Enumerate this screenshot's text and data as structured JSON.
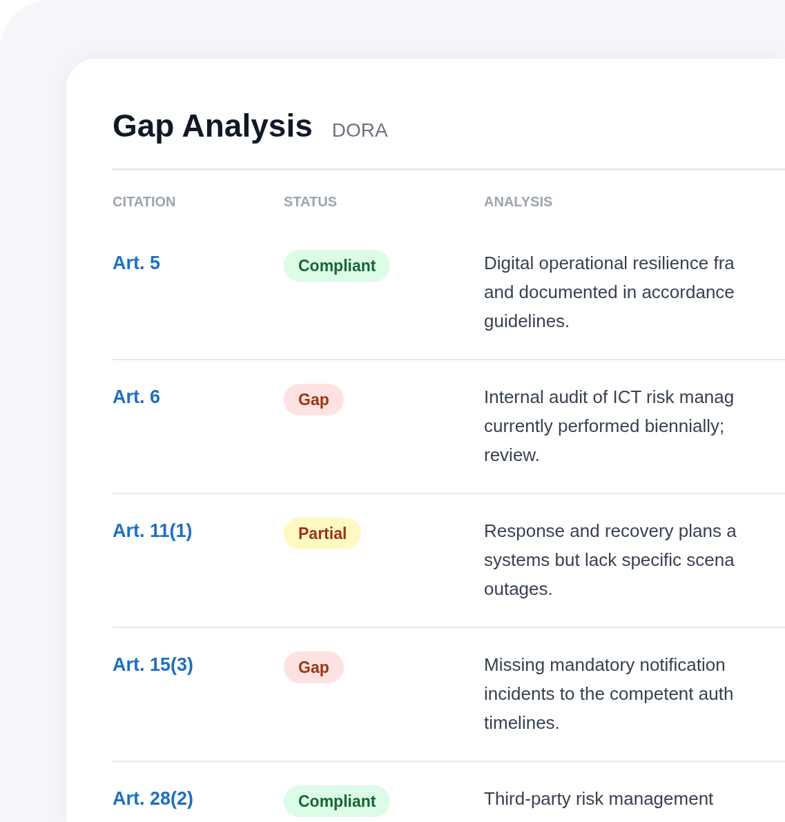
{
  "header": {
    "title": "Gap Analysis",
    "framework": "DORA"
  },
  "table": {
    "columns": [
      "CITATION",
      "STATUS",
      "ANALYSIS"
    ],
    "rows": [
      {
        "citation": "Art. 5",
        "status": {
          "label": "Compliant",
          "kind": "compliant"
        },
        "analysis": "Digital operational resilience fra\nand documented in accordance\nguidelines."
      },
      {
        "citation": "Art. 6",
        "status": {
          "label": "Gap",
          "kind": "gap"
        },
        "analysis": "Internal audit of ICT risk manag\ncurrently performed biennially;\nreview."
      },
      {
        "citation": "Art. 11(1)",
        "status": {
          "label": "Partial",
          "kind": "partial"
        },
        "analysis": "Response and recovery plans a\nsystems but lack specific scena\noutages."
      },
      {
        "citation": "Art. 15(3)",
        "status": {
          "label": "Gap",
          "kind": "gap"
        },
        "analysis": "Missing mandatory notification\nincidents to the competent auth\ntimelines."
      },
      {
        "citation": "Art. 28(2)",
        "status": {
          "label": "Compliant",
          "kind": "compliant"
        },
        "analysis": "Third-party risk management"
      }
    ]
  }
}
